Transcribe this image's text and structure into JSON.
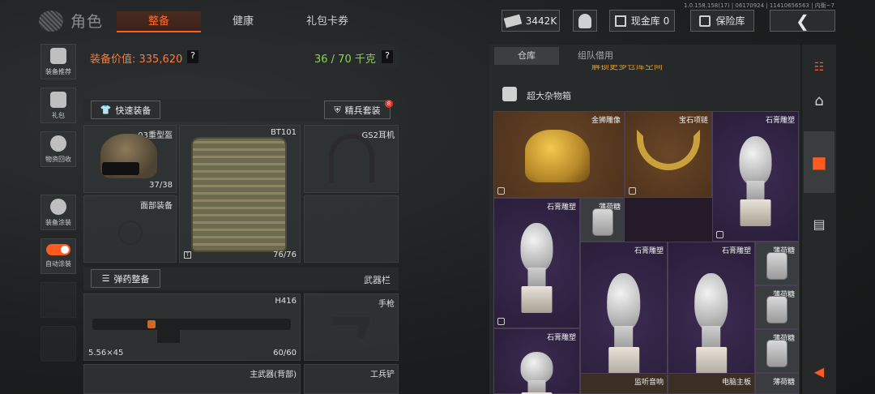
{
  "header": {
    "title": "角色",
    "tabs": [
      {
        "label": "整备",
        "active": true
      },
      {
        "label": "健康",
        "active": false
      },
      {
        "label": "礼包卡券",
        "active": false
      }
    ],
    "version": "1.0.158.158(17) | 06170924 | 11410656563 | 内衡~7",
    "currency": "3442K",
    "cash_vault": "现金库 0",
    "safe": "保险库"
  },
  "sidebar": [
    {
      "label": "装备推荐"
    },
    {
      "label": "礼包"
    },
    {
      "label": "物资回收"
    },
    {
      "label": "装备涂装"
    },
    {
      "label": "自动涂装"
    }
  ],
  "equipment": {
    "value_label": "装备价值: 335,620",
    "weight": "36 / 70 千克",
    "help": "?",
    "quick_equip": "快速装备",
    "elite_set": "精兵套装",
    "elite_badge": "8",
    "helmet": {
      "label": "03重型盔",
      "count": "37/38"
    },
    "armor": {
      "label": "BT101",
      "count": "76/76"
    },
    "headset": {
      "label": "GS2耳机"
    },
    "face": {
      "label": "面部装备"
    },
    "ammo_button": "弹药整备",
    "weapon_bar": "武器栏",
    "primary": {
      "label": "H416",
      "ammo": "5.56×45",
      "count": "60/60"
    },
    "pistol": {
      "label": "手枪"
    },
    "back_weapon": "主武器(背部)",
    "shovel": "工兵铲"
  },
  "storage": {
    "tabs": [
      {
        "label": "仓库",
        "active": true
      },
      {
        "label": "组队借用",
        "active": false
      }
    ],
    "banner": "解锁更多仓库空间",
    "box_name": "超大杂物箱",
    "items": [
      {
        "label": "金狮雕像"
      },
      {
        "label": "宝石项链"
      },
      {
        "label": "石膏雕塑"
      },
      {
        "label": "石膏雕塑"
      },
      {
        "label": "薄荷糖"
      },
      {
        "label": "石膏雕塑"
      },
      {
        "label": "石膏雕塑"
      },
      {
        "label": "薄荷糖"
      },
      {
        "label": "薄荷糖"
      },
      {
        "label": "石膏雕塑"
      },
      {
        "label": "薄荷糖"
      },
      {
        "label": "监听音响"
      },
      {
        "label": "电脑主板"
      },
      {
        "label": "薄荷糖"
      }
    ]
  },
  "colors": {
    "accent": "#ff5a1f",
    "value": "#ff7a3a",
    "weight": "#8fd14f"
  }
}
